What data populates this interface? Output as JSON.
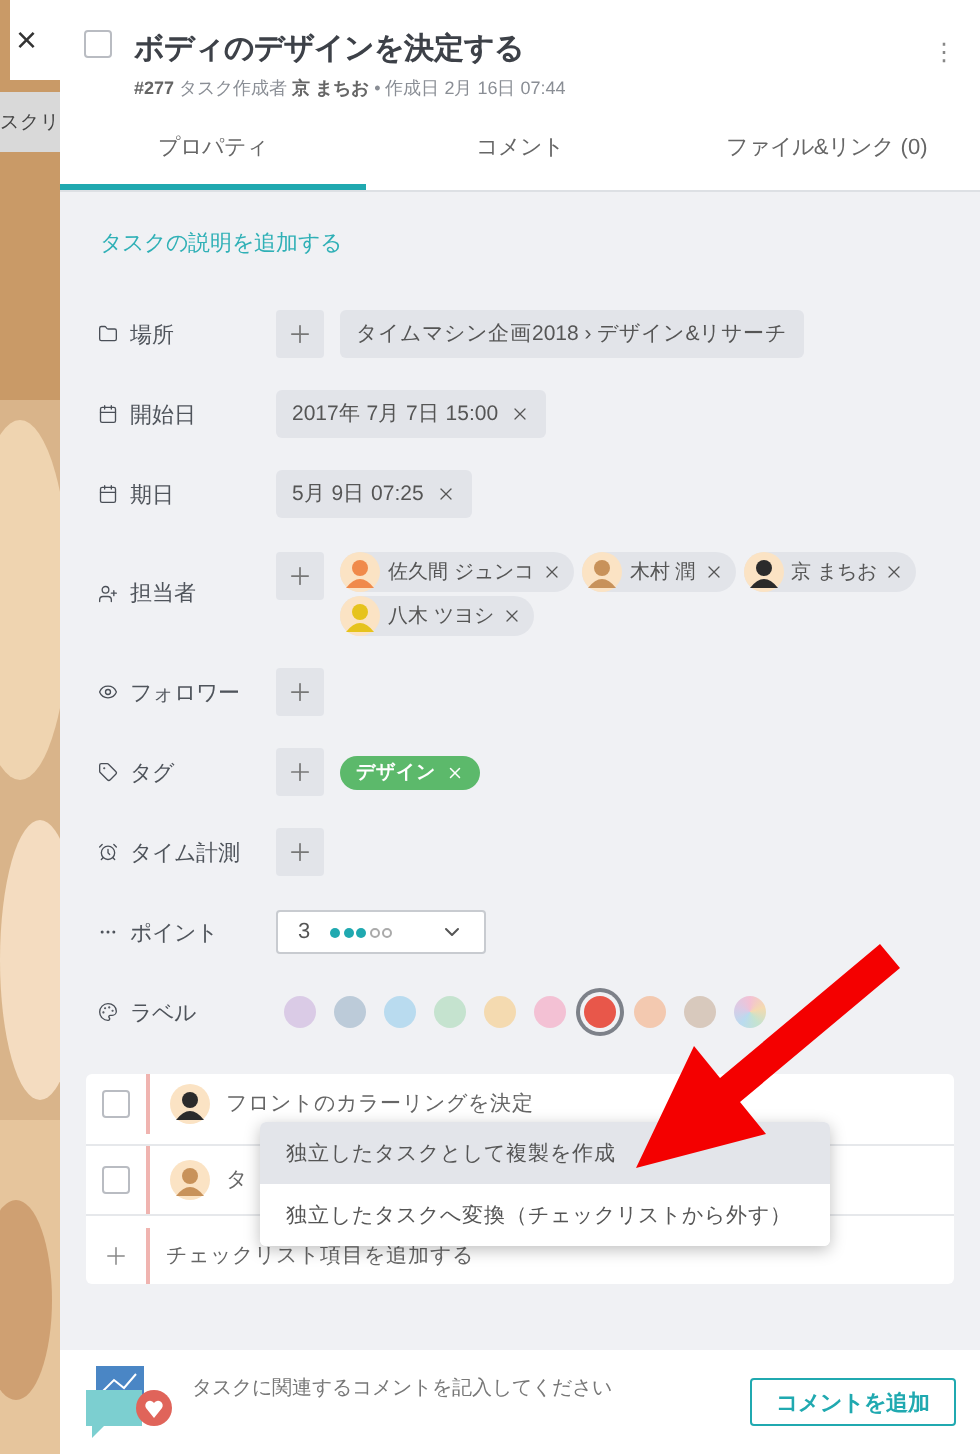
{
  "backdrop": {
    "close": "×",
    "peek_text": "スクリ"
  },
  "task": {
    "title": "ボディのデザインを決定する",
    "checked": false,
    "meta": "**#277** タスク作成者 **京 まちお** • 作成日 2月 16日 07:44",
    "menu": "⋮"
  },
  "tabs": [
    {
      "label": "プロパティ",
      "selected": true
    },
    {
      "label": "コメント",
      "selected": false
    },
    {
      "label": "ファイル&リンク (0)",
      "selected": false
    }
  ],
  "description_link": "タスクの説明を追加する",
  "properties": [
    {
      "kind": "location",
      "label": "場所",
      "value": "タイムマシン企画2018 › デザイン&リサーチ"
    },
    {
      "kind": "date",
      "label": "開始日",
      "value": "2017年 7月 7日 15:00"
    },
    {
      "kind": "date",
      "label": "期日",
      "value": "5月 9日 07:25"
    },
    {
      "kind": "people",
      "label": "担当者",
      "people": [
        {
          "name": "佐久間 ジュンコ",
          "color": "#f08a4b"
        },
        {
          "name": "木村 潤",
          "color": "#c8925a"
        },
        {
          "name": "京 まちお",
          "color": "#2b2b2b"
        },
        {
          "name": "八木 ツヨシ",
          "color": "#e6c31c"
        }
      ]
    },
    {
      "kind": "add",
      "label": "フォロワー"
    },
    {
      "kind": "tags",
      "label": "タグ",
      "tags": [
        {
          "name": "デザイン",
          "color": "#5cb96b"
        }
      ]
    },
    {
      "kind": "add",
      "label": "タイム計測"
    },
    {
      "kind": "points",
      "label": "ポイント",
      "value": "3",
      "stars": 3
    },
    {
      "kind": "labels",
      "label": "ラベル",
      "colors": [
        {
          "kind": "solid",
          "color": "#dacbe6",
          "selected": false
        },
        {
          "kind": "solid",
          "color": "#bccbd9",
          "selected": false
        },
        {
          "kind": "solid",
          "color": "#b9dbef",
          "selected": false
        },
        {
          "kind": "solid",
          "color": "#c5e3cf",
          "selected": false
        },
        {
          "kind": "solid",
          "color": "#f4dab0",
          "selected": false
        },
        {
          "kind": "solid",
          "color": "#f3c1d4",
          "selected": false
        },
        {
          "kind": "solid",
          "color": "#e8574a",
          "selected": true
        },
        {
          "kind": "solid",
          "color": "#f3c9b0",
          "selected": false
        },
        {
          "kind": "solid",
          "color": "#d8c9bd",
          "selected": false
        },
        {
          "kind": "multi",
          "selected": false
        }
      ]
    }
  ],
  "checklist": {
    "items": [
      {
        "text": "フロントのカラーリングを決定",
        "checked": false,
        "color": "#2b2b2b"
      },
      {
        "text": "タ",
        "checked": false,
        "color": "#c8925a"
      }
    ],
    "add_label": "チェックリスト項目を追加する"
  },
  "context_menu": [
    {
      "label": "独立したタスクとして複製を作成",
      "selected": true
    },
    {
      "label": "独立したタスクへ変換（チェックリストから外す）",
      "selected": false
    }
  ],
  "footer": {
    "prompt": "タスクに関連するコメントを記入してください",
    "button": "コメントを追加"
  }
}
